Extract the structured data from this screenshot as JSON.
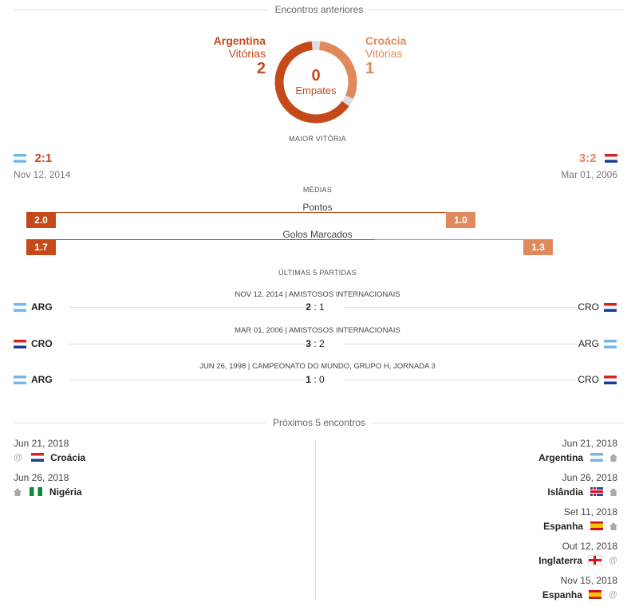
{
  "previous_section_title": "Encontros anteriores",
  "summary": {
    "team1_name": "Argentina",
    "team1_label": "Vitórias",
    "team1_wins": "2",
    "team2_name": "Croácia",
    "team2_label": "Vitórias",
    "team2_wins": "1",
    "draws": "0",
    "draws_label": "Empates",
    "colors": {
      "team1": "#c54a1a",
      "team2": "#e08a5c",
      "draws": "#dddddd"
    }
  },
  "biggest_win": {
    "title": "MAIOR VITÓRIA",
    "left": {
      "flag": "argentina-flag",
      "score": "2:1",
      "date": "Nov 12, 2014"
    },
    "right": {
      "flag": "croatia-flag",
      "score": "3:2",
      "date": "Mar 01, 2006"
    }
  },
  "averages": {
    "title": "MÉDIAS",
    "stats": [
      {
        "label": "Pontos",
        "left": "2.0",
        "right": "1.0"
      },
      {
        "label": "Golos Marcados",
        "left": "1.7",
        "right": "1.3"
      }
    ]
  },
  "last_matches": {
    "title": "ÚLTIMAS 5 PARTIDAS",
    "rows": [
      {
        "meta": "NOV 12, 2014  |  AMISTOSOS INTERNACIONAIS",
        "left": "ARG",
        "left_flag": "argentina-flag",
        "score_left": "2",
        "score_right": "1",
        "right": "CRO",
        "right_flag": "croatia-flag",
        "bold": "left"
      },
      {
        "meta": "MAR 01, 2006  |  AMISTOSOS INTERNACIONAIS",
        "left": "CRO",
        "left_flag": "croatia-flag",
        "score_left": "3",
        "score_right": "2",
        "right": "ARG",
        "right_flag": "argentina-flag",
        "bold": "left"
      },
      {
        "meta": "JUN 26, 1998  |  CAMPEONATO DO MUNDO, GRUPO H, JORNADA 3",
        "left": "ARG",
        "left_flag": "argentina-flag",
        "score_left": "1",
        "score_right": "0",
        "right": "CRO",
        "right_flag": "croatia-flag",
        "bold": "left"
      }
    ]
  },
  "next_section_title": "Próximos 5 encontros",
  "fixtures_left": [
    {
      "date": "Jun 21, 2018",
      "venue_icon": "at-icon",
      "flag": "croatia-flag",
      "team": "Croácia"
    },
    {
      "date": "Jun 26, 2018",
      "venue_icon": "home-icon",
      "flag": "nigeria-flag",
      "team": "Nigéria"
    }
  ],
  "fixtures_right": [
    {
      "date": "Jun 21, 2018",
      "team": "Argentina",
      "flag": "argentina-flag",
      "venue_icon": "home-icon"
    },
    {
      "date": "Jun 26, 2018",
      "team": "Islândia",
      "flag": "iceland-flag",
      "venue_icon": "home-icon"
    },
    {
      "date": "Set 11, 2018",
      "team": "Espanha",
      "flag": "spain-flag",
      "venue_icon": "home-icon"
    },
    {
      "date": "Out 12, 2018",
      "team": "Inglaterra",
      "flag": "england-flag",
      "venue_icon": "at-icon"
    },
    {
      "date": "Nov 15, 2018",
      "team": "Espanha",
      "flag": "spain-flag",
      "venue_icon": "at-icon"
    }
  ]
}
